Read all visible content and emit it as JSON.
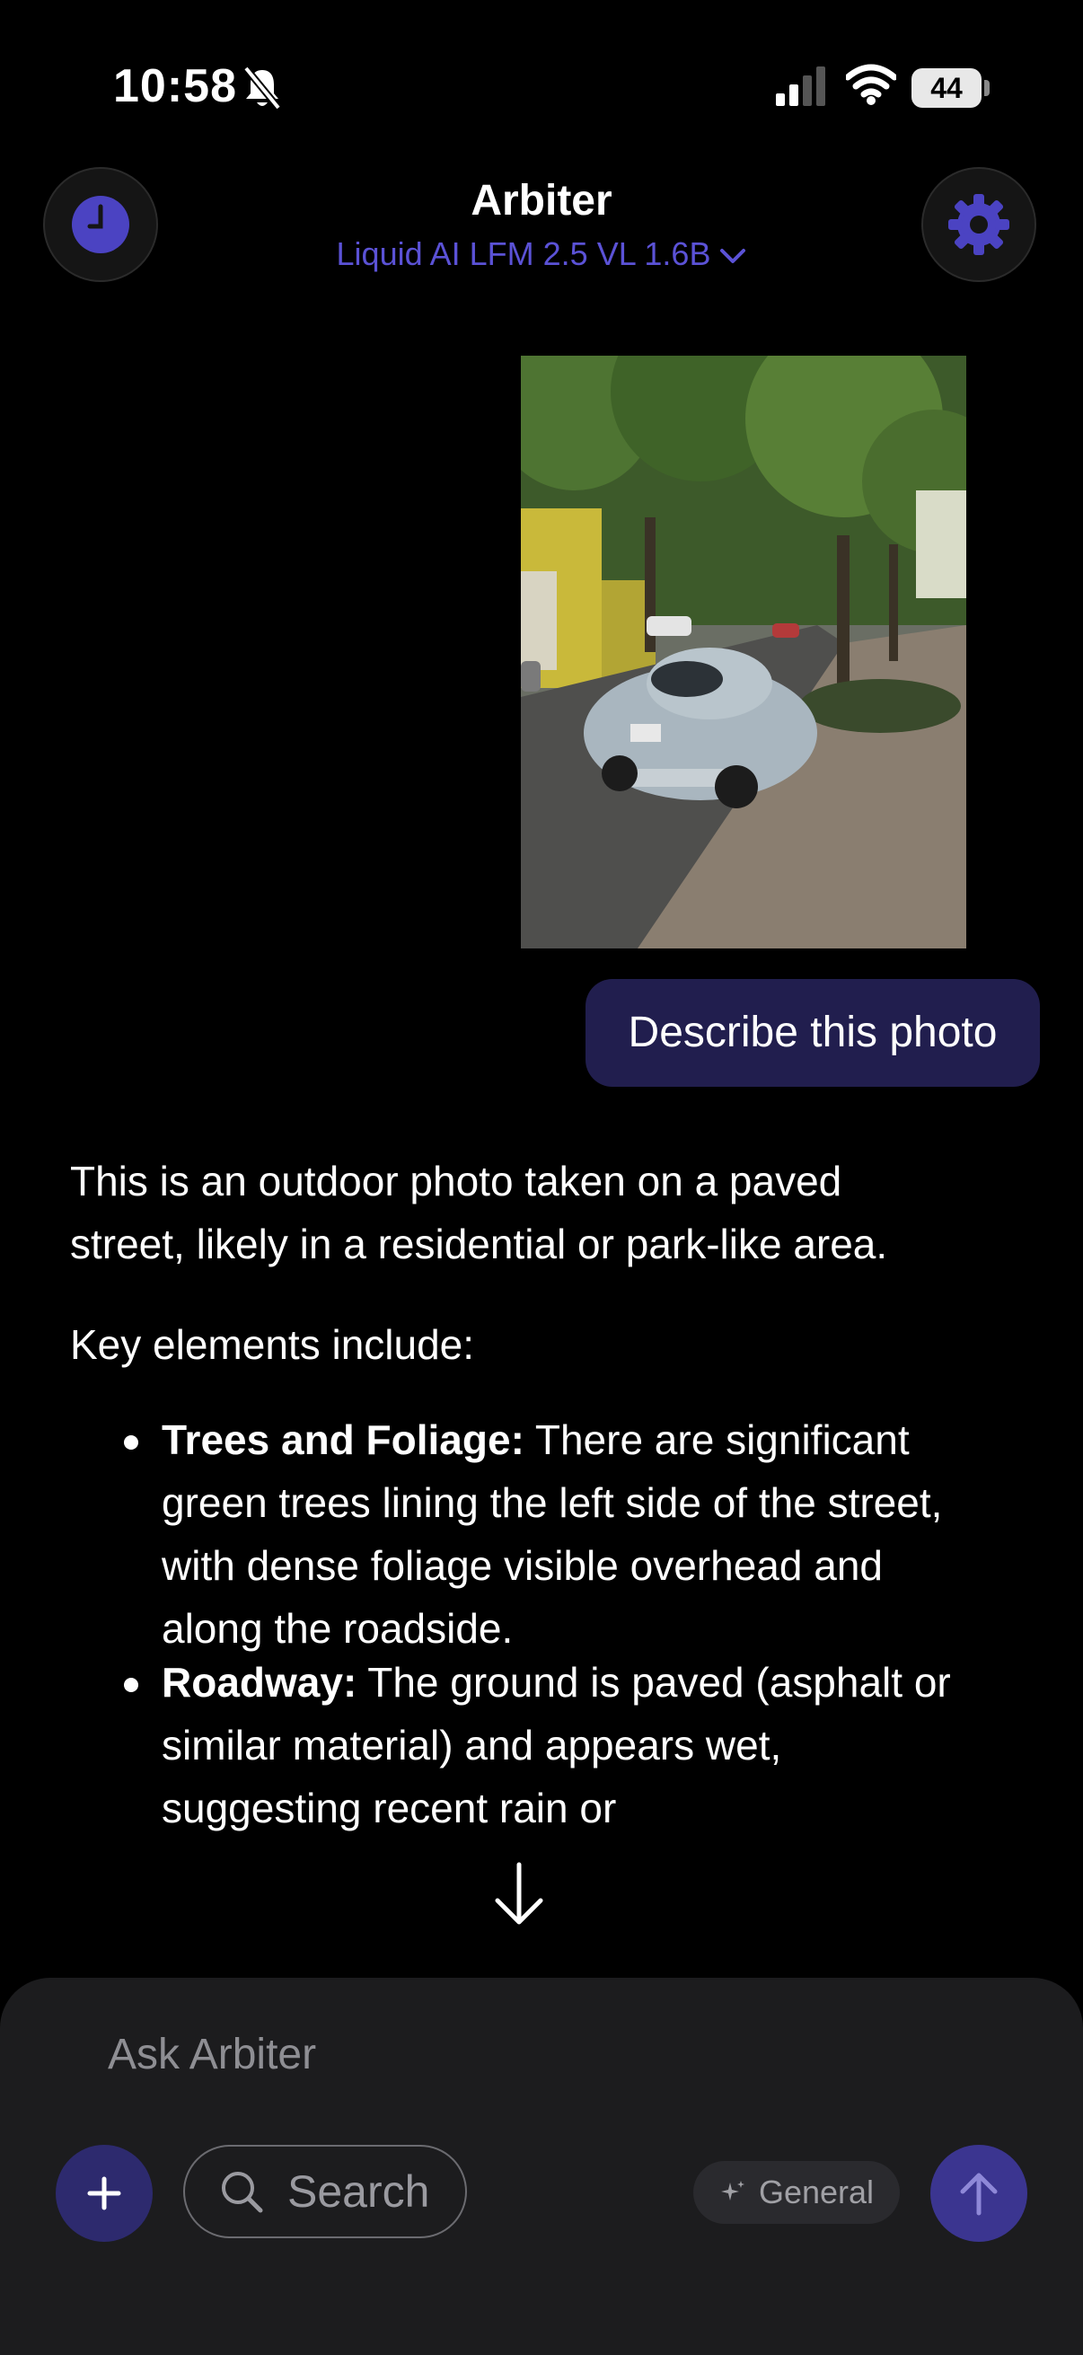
{
  "status_bar": {
    "time": "10:58",
    "battery": "44",
    "icons": [
      "bell-slash-icon",
      "cellular-signal-icon",
      "wifi-icon",
      "battery-icon"
    ]
  },
  "header": {
    "title": "Arbiter",
    "model": "Liquid AI LFM 2.5 VL 1.6B",
    "left_icon": "history-clock-icon",
    "right_icon": "gear-icon"
  },
  "conversation": {
    "user_message": "Describe this photo",
    "response": {
      "intro": "This is an outdoor photo taken on a paved street, likely in a residential or park-like area.",
      "lead": "Key elements include:",
      "bullets": [
        {
          "heading": "Trees and Foliage:",
          "text": " There are significant green trees lining the left side of the street, with dense foliage visible overhead and along the roadside."
        },
        {
          "heading": "Roadway:",
          "text": " The ground is paved (asphalt or similar material) and appears wet, suggesting recent rain or"
        }
      ]
    }
  },
  "composer": {
    "placeholder": "Ask Arbiter",
    "search_label": "Search",
    "mode_label": "General"
  },
  "colors": {
    "accent": "#5b52d6",
    "user_bubble": "#211e4e",
    "send_button": "#3b3590",
    "composer_bg": "#1c1c1e"
  }
}
